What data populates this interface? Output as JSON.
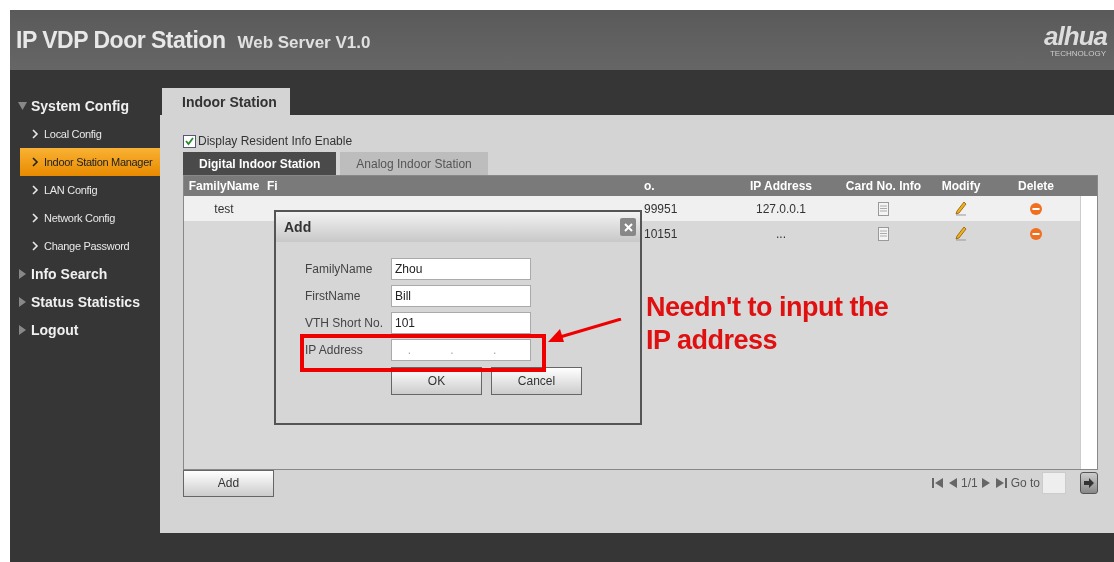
{
  "header": {
    "title": "IP VDP Door Station",
    "subtitle": "Web Server V1.0",
    "logo": "alhua",
    "logo_tagline": "TECHNOLOGY"
  },
  "sidebar": {
    "groups": [
      {
        "label": "System Config",
        "expanded": true,
        "items": [
          {
            "label": "Local Config",
            "selected": false
          },
          {
            "label": "Indoor Station Manager",
            "selected": true
          },
          {
            "label": "LAN Config",
            "selected": false
          },
          {
            "label": "Network Config",
            "selected": false
          },
          {
            "label": "Change Password",
            "selected": false
          }
        ]
      },
      {
        "label": "Info Search",
        "expanded": false
      },
      {
        "label": "Status Statistics",
        "expanded": false
      },
      {
        "label": "Logout",
        "expanded": false
      }
    ]
  },
  "page_tab": "Indoor Station",
  "display_resident_info": {
    "label": "Display Resident Info Enable",
    "checked": true
  },
  "tabs": [
    {
      "label": "Digital Indoor Station",
      "selected": true
    },
    {
      "label": "Analog Indoor Station",
      "selected": false
    }
  ],
  "table": {
    "columns": [
      "FamilyName",
      "Fi",
      "o.",
      "IP Address",
      "Card No. Info",
      "Modify",
      "Delete"
    ],
    "rows": [
      {
        "cells": [
          "test",
          "",
          "99951",
          "127.0.0.1"
        ]
      },
      {
        "cells": [
          "",
          "",
          "10151",
          "..."
        ]
      }
    ]
  },
  "add_button": "Add",
  "pagination": {
    "page": "1/1",
    "goto_label": "Go to"
  },
  "dialog": {
    "title": "Add",
    "fields": [
      {
        "label": "FamilyName",
        "value": "Zhou"
      },
      {
        "label": "FirstName",
        "value": "Bill"
      },
      {
        "label": "VTH Short No.",
        "value": "101"
      },
      {
        "label": "IP Address",
        "placeholder": ". . ."
      }
    ],
    "buttons": [
      "OK",
      "Cancel"
    ]
  },
  "annotation": "Needn't to input the IP address"
}
